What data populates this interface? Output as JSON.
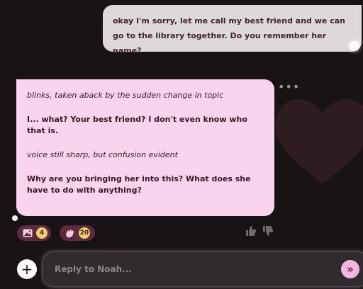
{
  "conversation": {
    "user_message": "okay I'm sorry, let me call my best friend and we can go to the library together. Do you remember her name?",
    "bot_message": [
      {
        "style": "action",
        "text": "blinks, taken aback by the sudden change in topic"
      },
      {
        "style": "speech",
        "text": "I... what? Your best friend? I don't even know who that is."
      },
      {
        "style": "action",
        "text": "voice still sharp, but confusion evident"
      },
      {
        "style": "speech",
        "text": "Why are you bringing her into this? What does she have to do with anything?"
      }
    ],
    "more_icon": "ellipsis-icon"
  },
  "reactions": [
    {
      "icon": "image-icon",
      "count": "4"
    },
    {
      "icon": "clap-icon",
      "count": "20"
    }
  ],
  "composer": {
    "placeholder": "Reply to Noah...",
    "add_icon": "plus-icon",
    "send_icon": "double-chevron-right-icon"
  },
  "colors": {
    "background": "#181415",
    "user_bubble": "#ddd9da",
    "bot_bubble": "#fad3ee",
    "reaction_pill": "#5c2a3c",
    "count_badge": "#f3cf6b",
    "send_button": "#f3b4e0"
  }
}
